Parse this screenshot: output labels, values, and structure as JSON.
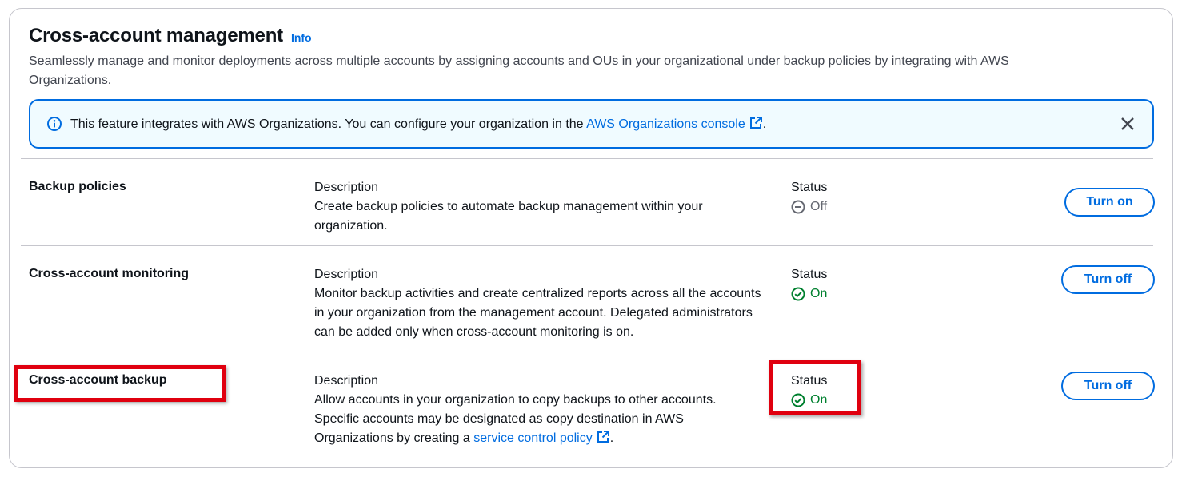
{
  "header": {
    "title": "Cross-account management",
    "info_label": "Info",
    "description": "Seamlessly manage and monitor deployments across multiple accounts by assigning accounts and OUs in your organizational under backup policies by integrating with AWS Organizations."
  },
  "alert": {
    "text_before": "This feature integrates with AWS Organizations. You can configure your organization in the ",
    "link_text": "AWS Organizations console",
    "text_after": "."
  },
  "rows": [
    {
      "name": "Backup policies",
      "desc_label": "Description",
      "desc_text": "Create backup policies to automate backup management within your organization.",
      "status_label": "Status",
      "status_value": "Off",
      "button_label": "Turn on"
    },
    {
      "name": "Cross-account monitoring",
      "desc_label": "Description",
      "desc_text": "Monitor backup activities and create centralized reports across all the accounts in your organization from the management account. Delegated administrators can be added only when cross-account monitoring is on.",
      "status_label": "Status",
      "status_value": "On",
      "button_label": "Turn off"
    },
    {
      "name": "Cross-account backup",
      "desc_label": "Description",
      "desc_text_before": "Allow accounts in your organization to copy backups to other accounts. Specific accounts may be designated as copy destination in AWS Organizations by creating a ",
      "desc_link": "service control policy",
      "desc_text_after": ".",
      "status_label": "Status",
      "status_value": "On",
      "button_label": "Turn off"
    }
  ],
  "colors": {
    "accent": "#006ce0",
    "status_on": "#00802f",
    "status_off": "#656871",
    "highlight": "#e0000f"
  },
  "icons": [
    "info-circle-icon",
    "external-link-icon",
    "close-icon",
    "status-off-icon",
    "status-on-icon"
  ]
}
